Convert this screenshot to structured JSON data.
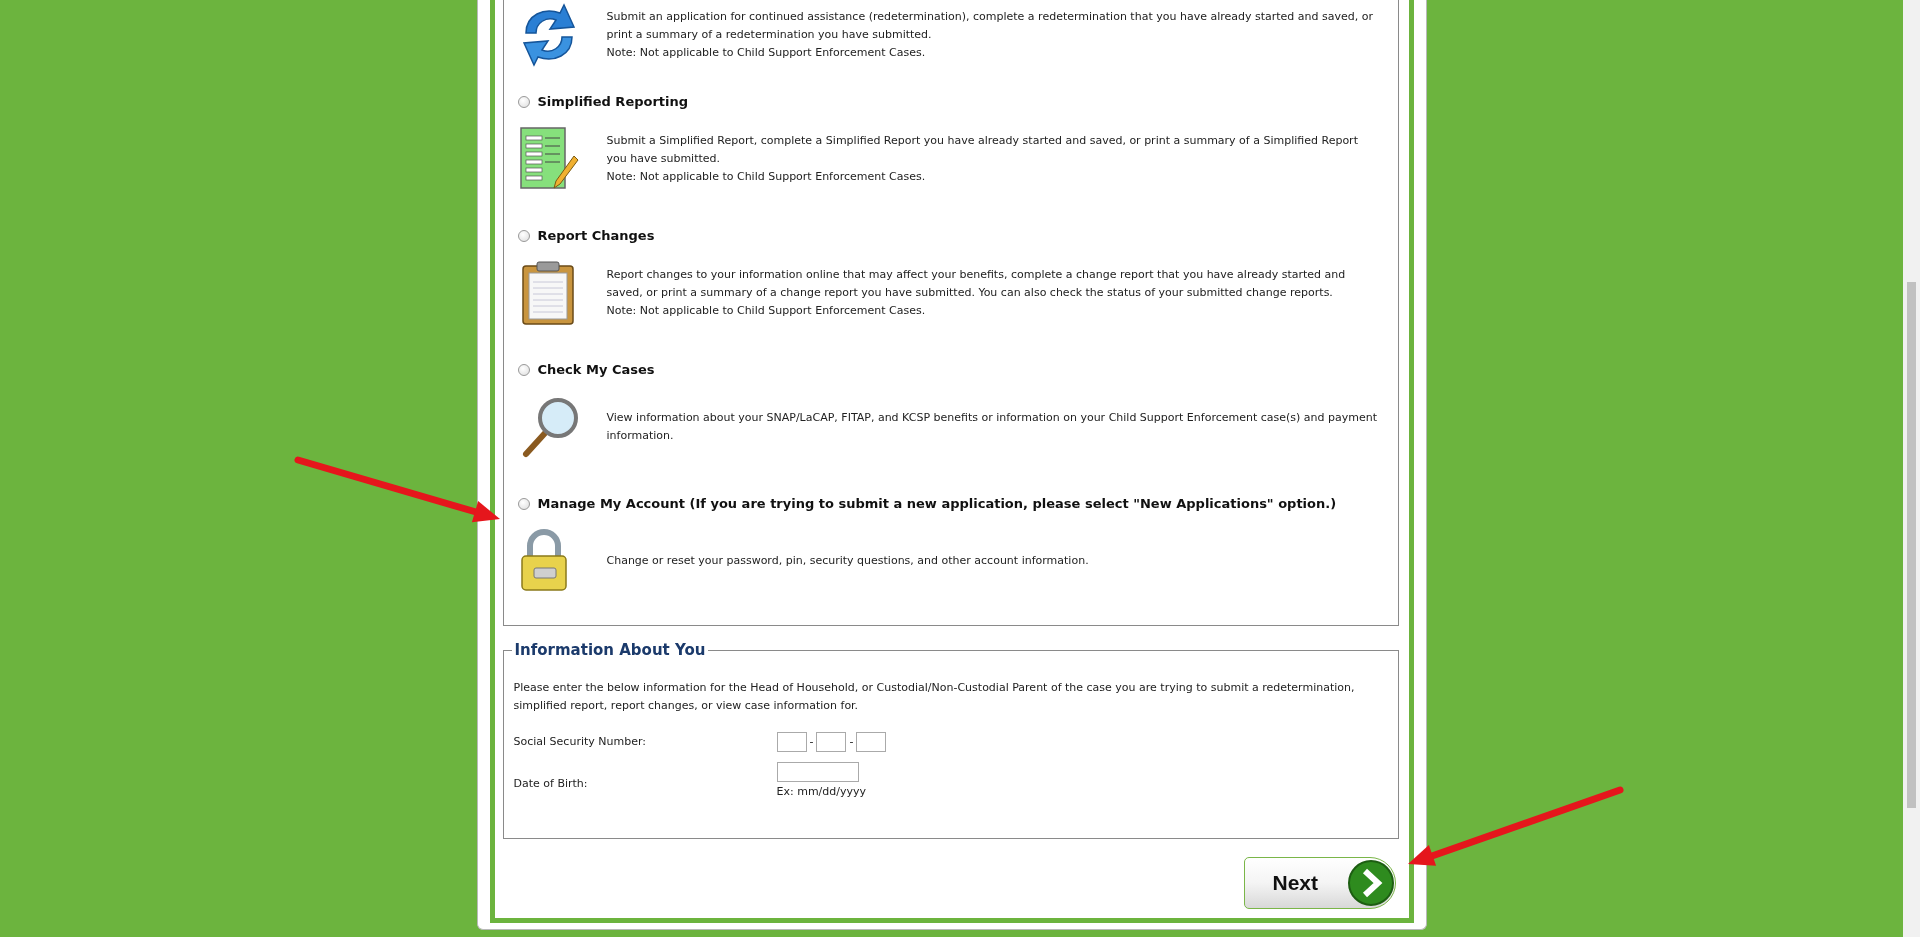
{
  "options": [
    {
      "kind": "refresh",
      "description": "Submit an application for continued assistance (redetermination), complete a redetermination that you have already started and saved, or print a summary of a redetermination you have submitted.",
      "note": "Note: Not applicable to Child Support Enforcement Cases."
    },
    {
      "kind": "form",
      "title": "Simplified Reporting",
      "selected": false,
      "description": "Submit a Simplified Report, complete a Simplified Report you have already started and saved, or print a summary of a Simplified Report you have submitted.",
      "note": "Note: Not applicable to Child Support Enforcement Cases."
    },
    {
      "kind": "clipboard",
      "title": "Report Changes",
      "selected": false,
      "description": "Report changes to your information online that may affect your benefits, complete a change report that you have already started and saved, or print a summary of a change report you have submitted. You can also check the status of your submitted change reports.",
      "note": "Note: Not applicable to Child Support Enforcement Cases."
    },
    {
      "kind": "magnifier",
      "title": "Check My Cases",
      "selected": false,
      "description": "View information about your SNAP/LaCAP, FITAP, and KCSP benefits or information on your Child Support Enforcement case(s) and payment information."
    },
    {
      "kind": "padlock",
      "title": "Manage My Account (If you are trying to submit a new application, please select \"New Applications\" option.)",
      "selected": false,
      "description": "Change or reset your password, pin, security questions, and other account information."
    }
  ],
  "info": {
    "legend": "Information About You",
    "intro": "Please enter the below information for the Head of Household, or Custodial/Non-Custodial Parent of the case you are trying to submit a redetermination, simplified report, report changes, or view case information for.",
    "ssn_label": "Social Security Number:",
    "ssn_separators": [
      "-",
      "-"
    ],
    "dob_label": "Date of Birth:",
    "dob_hint": "Ex: mm/dd/yyyy"
  },
  "next_button": "Next"
}
